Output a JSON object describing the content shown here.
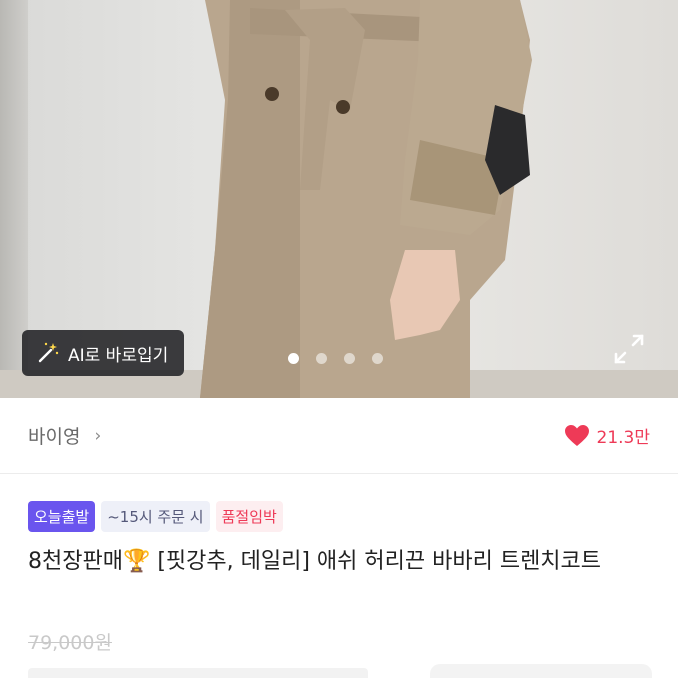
{
  "hero": {
    "ai_button_label": "AI로 바로입기",
    "ai_icon": "magic-wand-icon",
    "expand_icon": "expand-icon",
    "carousel": {
      "total": 4,
      "active_index": 1
    }
  },
  "seller": {
    "name": "바이영",
    "chevron": "›"
  },
  "likes": {
    "count": "21.3만",
    "icon": "heart-icon",
    "color": "#ee3a57"
  },
  "badges": [
    {
      "label": "오늘출발",
      "color": "#6a55ee"
    },
    {
      "label": "~15시 주문 시"
    },
    {
      "label": "품절임박",
      "color": "#ee3a57"
    }
  ],
  "product": {
    "title": "8천장판매🏆 [핏강추, 데일리] 애쉬 허리끈 바바리 트렌치코트",
    "original_price": "79,000원"
  }
}
